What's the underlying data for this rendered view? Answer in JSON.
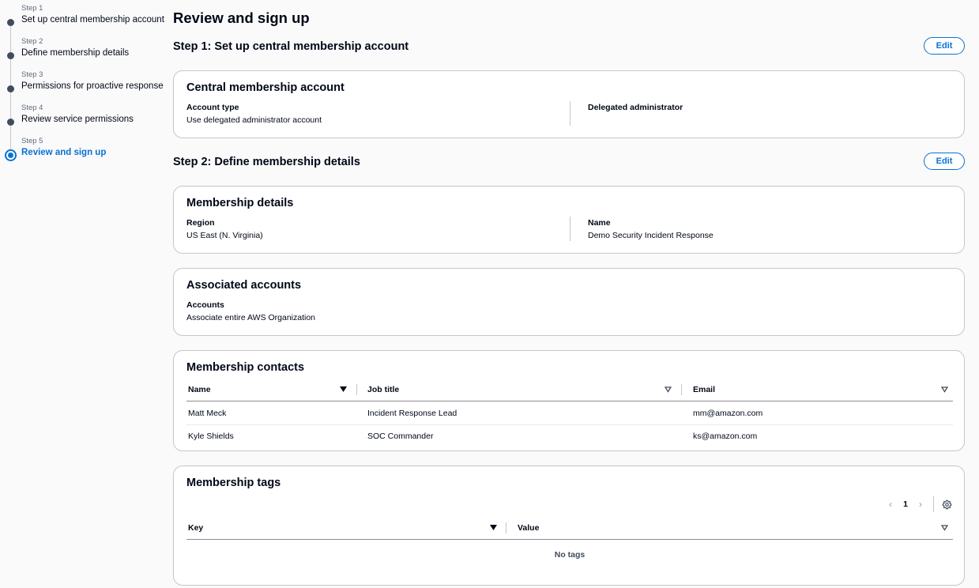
{
  "stepper": [
    {
      "step": "Step 1",
      "label": "Set up central membership account",
      "active": false
    },
    {
      "step": "Step 2",
      "label": "Define membership details",
      "active": false
    },
    {
      "step": "Step 3",
      "label": "Permissions for proactive response",
      "active": false
    },
    {
      "step": "Step 4",
      "label": "Review service permissions",
      "active": false
    },
    {
      "step": "Step 5",
      "label": "Review and sign up",
      "active": true
    }
  ],
  "page_title": "Review and sign up",
  "edit_label": "Edit",
  "step1": {
    "title": "Step 1: Set up central membership account",
    "card_title": "Central membership account",
    "account_type_label": "Account type",
    "account_type_value": "Use delegated administrator account",
    "delegated_admin_label": "Delegated administrator",
    "delegated_admin_value": ""
  },
  "step2": {
    "title": "Step 2: Define membership details",
    "details": {
      "card_title": "Membership details",
      "region_label": "Region",
      "region_value": "US East (N. Virginia)",
      "name_label": "Name",
      "name_value": "Demo Security Incident Response"
    },
    "associated": {
      "card_title": "Associated accounts",
      "accounts_label": "Accounts",
      "accounts_value": "Associate entire AWS Organization"
    },
    "contacts": {
      "card_title": "Membership contacts",
      "columns": [
        "Name",
        "Job title",
        "Email"
      ],
      "rows": [
        [
          "Matt Meck",
          "Incident Response Lead",
          "mm@amazon.com"
        ],
        [
          "Kyle Shields",
          "SOC Commander",
          "ks@amazon.com"
        ]
      ]
    },
    "tags": {
      "card_title": "Membership tags",
      "page_number": "1",
      "columns": [
        "Key",
        "Value"
      ],
      "empty_text": "No tags"
    }
  },
  "icons": {
    "sort_active": "caret-down-filled-icon",
    "sort_inactive": "caret-down-outline-icon",
    "prev": "chevron-left-icon",
    "next": "chevron-right-icon",
    "settings": "gear-icon"
  },
  "colors": {
    "accent": "#0972d3",
    "text": "#000716",
    "border": "#c6c6cd",
    "background": "#fafafa"
  }
}
